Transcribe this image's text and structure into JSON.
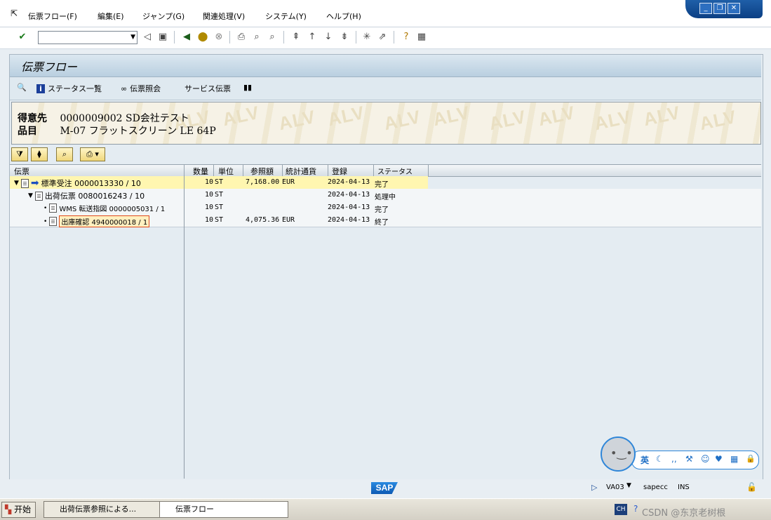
{
  "menu": {
    "items": [
      "伝票フロー(F)",
      "編集(E)",
      "ジャンプ(G)",
      "関連処理(V)",
      "システム(Y)",
      "ヘルプ(H)"
    ]
  },
  "command_field": {
    "value": ""
  },
  "screen": {
    "title": "伝票フロー",
    "app_toolbar": {
      "status_list": "ステータス一覧",
      "doc_display": "伝票照会",
      "service_docs": "サービス伝票"
    },
    "header": {
      "customer_label": "得意先",
      "customer_value": "0000009002 SD会社テスト",
      "material_label": "品目",
      "material_value": "M-07 フラットスクリーン LE 64P",
      "watermark": "ALV"
    },
    "columns": [
      "伝票",
      "数量",
      "単位",
      "参照額",
      "統計通貨",
      "登録",
      "ステータス"
    ],
    "rows": [
      {
        "doc": "標準受注 0000013330 / 10",
        "qty": "10",
        "unit": "ST",
        "amount": "7,168.00",
        "currency": "EUR",
        "date": "2024-04-13",
        "status": "完了"
      },
      {
        "doc": "出荷伝票 0080016243 / 10",
        "qty": "10",
        "unit": "ST",
        "amount": "",
        "currency": "",
        "date": "2024-04-13",
        "status": "処理中"
      },
      {
        "doc": "WMS 転送指図 0000005031 / 1",
        "qty": "10",
        "unit": "ST",
        "amount": "",
        "currency": "",
        "date": "2024-04-13",
        "status": "完了"
      },
      {
        "doc": "出庫確認 4940000018 / 1",
        "qty": "10",
        "unit": "ST",
        "amount": "4,075.36",
        "currency": "EUR",
        "date": "2024-04-13",
        "status": "終了"
      }
    ]
  },
  "status_bar": {
    "logo": "SAP",
    "transaction": "VA03",
    "system": "sapecc",
    "mode": "INS"
  },
  "taskbar": {
    "start": "开始",
    "tasks": [
      "出荷伝票参照による...",
      "伝票フロー"
    ],
    "lang": "CH",
    "watermark": "CSDN @东京老树根"
  },
  "ime": {
    "label": "英"
  },
  "colors": {
    "highlight_row": "#fff6b0",
    "selected_cell_border": "#e04a1a",
    "accent": "#0d5ab4"
  }
}
